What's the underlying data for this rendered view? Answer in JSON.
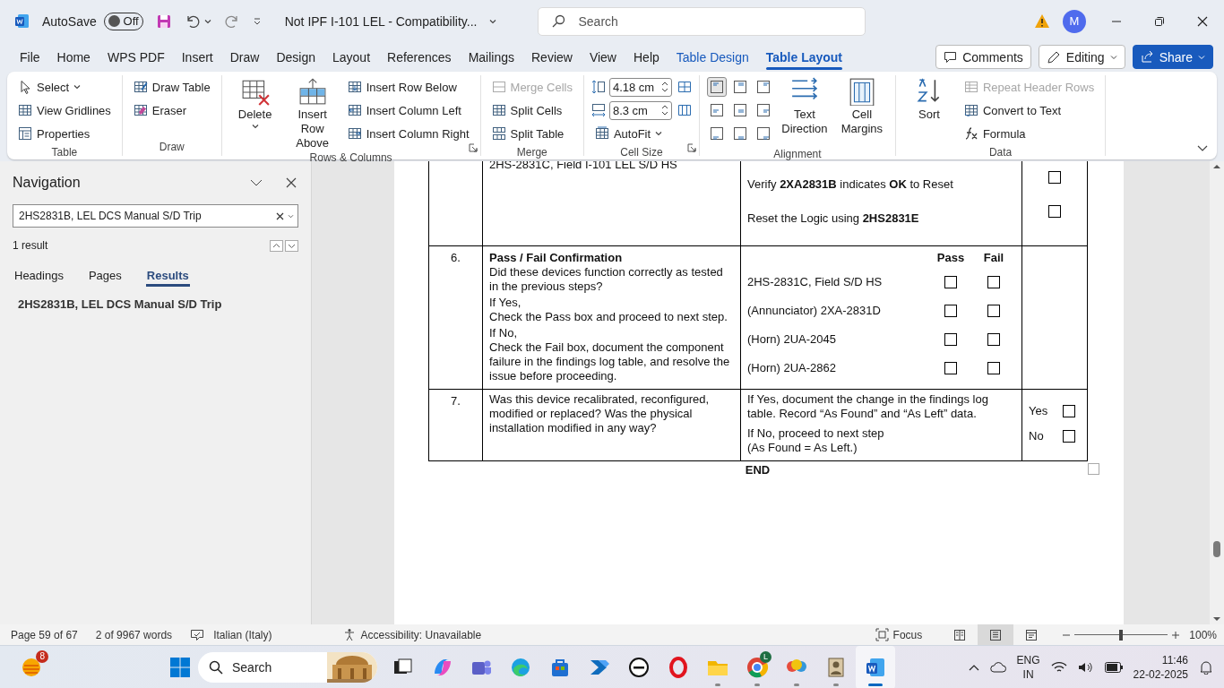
{
  "title_bar": {
    "autosave_label": "AutoSave",
    "autosave": {
      "on": false,
      "label": "Off"
    },
    "document_title": "Not IPF I-101 LEL  -  Compatibility...",
    "search": {
      "placeholder": "Search"
    },
    "account_initial": "M"
  },
  "ribbon_tabs": [
    {
      "label": "File",
      "selected": false,
      "contextual": false
    },
    {
      "label": "Home",
      "selected": false,
      "contextual": false
    },
    {
      "label": "WPS PDF",
      "selected": false,
      "contextual": false
    },
    {
      "label": "Insert",
      "selected": false,
      "contextual": false
    },
    {
      "label": "Draw",
      "selected": false,
      "contextual": false
    },
    {
      "label": "Design",
      "selected": false,
      "contextual": false
    },
    {
      "label": "Layout",
      "selected": false,
      "contextual": false
    },
    {
      "label": "References",
      "selected": false,
      "contextual": false
    },
    {
      "label": "Mailings",
      "selected": false,
      "contextual": false
    },
    {
      "label": "Review",
      "selected": false,
      "contextual": false
    },
    {
      "label": "View",
      "selected": false,
      "contextual": false
    },
    {
      "label": "Help",
      "selected": false,
      "contextual": false
    },
    {
      "label": "Table Design",
      "selected": false,
      "contextual": true
    },
    {
      "label": "Table Layout",
      "selected": true,
      "contextual": true
    }
  ],
  "ribbon_actions": {
    "comments": "Comments",
    "editing": "Editing",
    "share": "Share"
  },
  "ribbon_groups": [
    {
      "title": "Table",
      "launcher": false,
      "items": [
        {
          "kind": "small",
          "label": "Select",
          "dropdown": true,
          "disabled": false
        },
        {
          "kind": "small",
          "label": "View Gridlines",
          "dropdown": false,
          "disabled": false
        },
        {
          "kind": "small",
          "label": "Properties",
          "dropdown": false,
          "disabled": false
        }
      ]
    },
    {
      "title": "Draw",
      "launcher": false,
      "items": [
        {
          "kind": "small",
          "label": "Draw Table",
          "dropdown": false,
          "disabled": false
        },
        {
          "kind": "small",
          "label": "Eraser",
          "dropdown": false,
          "disabled": false
        }
      ]
    },
    {
      "title": "Rows & Columns",
      "launcher": true,
      "items": [
        {
          "kind": "large",
          "label": "Delete",
          "dropdown": true,
          "disabled": false
        },
        {
          "kind": "large",
          "label": "Insert Row Above",
          "dropdown": false,
          "disabled": false
        },
        {
          "kind": "small",
          "label": "Insert Row Below",
          "dropdown": false,
          "disabled": false
        },
        {
          "kind": "small",
          "label": "Insert Column Left",
          "dropdown": false,
          "disabled": false
        },
        {
          "kind": "small",
          "label": "Insert Column Right",
          "dropdown": false,
          "disabled": false
        }
      ]
    },
    {
      "title": "Merge",
      "launcher": false,
      "items": [
        {
          "kind": "small",
          "label": "Merge Cells",
          "dropdown": false,
          "disabled": true
        },
        {
          "kind": "small",
          "label": "Split Cells",
          "dropdown": false,
          "disabled": false
        },
        {
          "kind": "small",
          "label": "Split Table",
          "dropdown": false,
          "disabled": false
        }
      ]
    },
    {
      "title": "Cell Size",
      "launcher": true,
      "items": [
        {
          "kind": "spinner",
          "value": "4.18 cm"
        },
        {
          "kind": "spinner",
          "value": "8.3 cm"
        },
        {
          "kind": "small",
          "label": "AutoFit",
          "dropdown": true,
          "disabled": false
        },
        {
          "kind": "icon"
        },
        {
          "kind": "icon"
        }
      ]
    },
    {
      "title": "Alignment",
      "launcher": false,
      "items": [
        {
          "kind": "align",
          "selected": true
        },
        {
          "kind": "align",
          "selected": false
        },
        {
          "kind": "align",
          "selected": false
        },
        {
          "kind": "align",
          "selected": false
        },
        {
          "kind": "align",
          "selected": false
        },
        {
          "kind": "align",
          "selected": false
        },
        {
          "kind": "align",
          "selected": false
        },
        {
          "kind": "align",
          "selected": false
        },
        {
          "kind": "align",
          "selected": false
        },
        {
          "kind": "large",
          "label": "Text Direction",
          "dropdown": false,
          "disabled": false
        },
        {
          "kind": "large",
          "label": "Cell Margins",
          "dropdown": false,
          "disabled": false
        }
      ]
    },
    {
      "title": "Data",
      "launcher": false,
      "items": [
        {
          "kind": "large",
          "label": "Sort",
          "dropdown": false,
          "disabled": false
        },
        {
          "kind": "small",
          "label": "Repeat Header Rows",
          "dropdown": false,
          "disabled": true
        },
        {
          "kind": "small",
          "label": "Convert to Text",
          "dropdown": false,
          "disabled": false
        },
        {
          "kind": "small",
          "label": "Formula",
          "dropdown": false,
          "disabled": false
        }
      ]
    }
  ],
  "navigation": {
    "title": "Navigation",
    "search": {
      "value": "2HS2831B, LEL DCS Manual S/D Trip"
    },
    "result_count": "1 result",
    "tabs": [
      {
        "label": "Headings",
        "selected": false
      },
      {
        "label": "Pages",
        "selected": false
      },
      {
        "label": "Results",
        "selected": true
      }
    ],
    "results": [
      "2HS2831B, LEL DCS Manual S/D Trip"
    ]
  },
  "document": {
    "rows": [
      {
        "kind": "steps",
        "text": "2HS-2831C, Field I-101 LEL S/D HS",
        "steps": [
          {
            "text": "Verify **2XA2831B** indicates **OK** to Reset",
            "checked": false
          },
          {
            "text": "Reset the Logic using **2HS2831E**",
            "checked": false
          }
        ]
      },
      {
        "kind": "pass_fail",
        "number": "6.",
        "title": "Pass / Fail Confirmation",
        "paragraphs": [
          "Did these devices function correctly as tested in the previous steps?",
          "If Yes,\nCheck the Pass box and proceed to next step.",
          "If No,\nCheck the Fail box, document the component failure in the findings log table, and resolve the issue before proceeding."
        ],
        "columns": [
          "Pass",
          "Fail"
        ],
        "items": [
          {
            "label": "2HS-2831C, Field S/D HS",
            "pass": false,
            "fail": false
          },
          {
            "label": "(Annunciator) 2XA-2831D",
            "pass": false,
            "fail": false
          },
          {
            "label": "(Horn) 2UA-2045",
            "pass": false,
            "fail": false
          },
          {
            "label": "(Horn) 2UA-2862",
            "pass": false,
            "fail": false
          }
        ]
      },
      {
        "kind": "question",
        "number": "7.",
        "paragraphs": [
          "Was this device recalibrated, reconfigured, modified or replaced? Was the physical installation modified in any way?"
        ],
        "notes": [
          "If Yes, document the change in the findings log table. Record “As Found” and “As Left” data.",
          "If No, proceed to next step\n(As Found = As Left.)"
        ],
        "answers": [
          {
            "label": "Yes",
            "checked": false
          },
          {
            "label": "No",
            "checked": false
          }
        ]
      }
    ],
    "end": "END"
  },
  "status_bar": {
    "page": "Page 59 of 67",
    "words": "2 of 9967 words",
    "language": "Italian (Italy)",
    "accessibility": "Accessibility: Unavailable",
    "focus": "Focus",
    "views": [
      {
        "selected": false
      },
      {
        "selected": true
      },
      {
        "selected": false
      }
    ],
    "zoom": {
      "level": 0.5,
      "label": "100%"
    }
  },
  "taskbar": {
    "widget_badge": "8",
    "search": {
      "placeholder": "Search"
    },
    "apps": [
      {
        "running": false,
        "active": false
      },
      {
        "running": false,
        "active": false
      },
      {
        "running": false,
        "active": false
      },
      {
        "running": false,
        "active": false
      },
      {
        "running": false,
        "active": false
      },
      {
        "running": false,
        "active": false
      },
      {
        "running": false,
        "active": false
      },
      {
        "running": false,
        "active": false
      },
      {
        "running": true,
        "active": false
      },
      {
        "running": true,
        "active": false,
        "badge": "L"
      },
      {
        "running": true,
        "active": false
      },
      {
        "running": true,
        "active": false
      },
      {
        "running": true,
        "active": true
      }
    ],
    "language": [
      "ENG",
      "IN"
    ],
    "time": "11:46",
    "date": "22-02-2025"
  }
}
